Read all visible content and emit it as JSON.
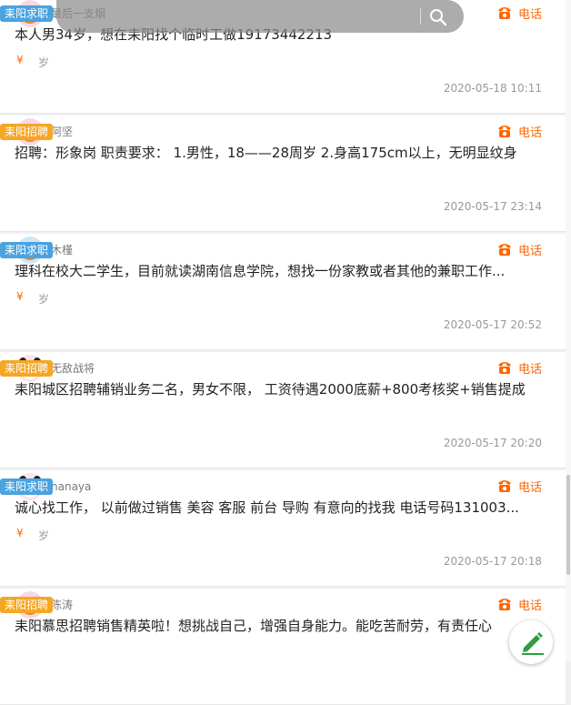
{
  "search": {
    "placeholder": ""
  },
  "posts": [
    {
      "user": "最后一支烟",
      "tag": "耒阳求职",
      "tag_type": "seek",
      "avatar": "fox",
      "content": "本人男34岁，想在耒阳找个临时工做19173442213",
      "salary": "¥",
      "age": "岁",
      "phone_label": "电话",
      "time": "2020-05-18 10:11"
    },
    {
      "user": "阿坚",
      "tag": "耒阳招聘",
      "tag_type": "hire",
      "avatar": "fox",
      "content": "招聘：形象岗 职责要求： 1.男性，18——28周岁 2.身高175cm以上，无明显纹身",
      "salary": "",
      "age": "",
      "phone_label": "电话",
      "time": "2020-05-17 23:14"
    },
    {
      "user": "木槿",
      "tag": "耒阳求职",
      "tag_type": "seek",
      "avatar": "fox2",
      "content": "理科在校大二学生，目前就读湖南信息学院，想找一份家教或者其他的兼职工作...",
      "salary": "¥",
      "age": "岁",
      "phone_label": "电话",
      "time": "2020-05-17 20:52"
    },
    {
      "user": "无敌战将",
      "tag": "耒阳招聘",
      "tag_type": "hire",
      "avatar": "panda",
      "content": "耒阳城区招聘辅销业务二名，男女不限， 工资待遇2000底薪+800考核奖+销售提成",
      "salary": "",
      "age": "",
      "phone_label": "电话",
      "time": "2020-05-17 20:20"
    },
    {
      "user": "nanaya",
      "tag": "耒阳求职",
      "tag_type": "seek",
      "avatar": "panda",
      "content": "诚心找工作， 以前做过销售 美容 客服 前台 导购 有意向的找我 电话号码131003...",
      "salary": "¥",
      "age": "岁",
      "phone_label": "电话",
      "time": "2020-05-17 20:18"
    },
    {
      "user": "陈涛",
      "tag": "耒阳招聘",
      "tag_type": "hire",
      "avatar": "fox",
      "content": "耒阳慕思招聘销售精英啦！想挑战自己，增强自身能力。能吃苦耐劳，有责任心",
      "salary": "",
      "age": "",
      "phone_label": "电话",
      "time": ""
    }
  ],
  "icons": {
    "phone": "phone-icon",
    "search": "search-icon",
    "compose": "pencil-icon"
  },
  "colors": {
    "accent": "#ff6600",
    "hire_tag": "#f5a623",
    "seek_tag": "#4aa3df",
    "fab": "#2e9e3e"
  }
}
